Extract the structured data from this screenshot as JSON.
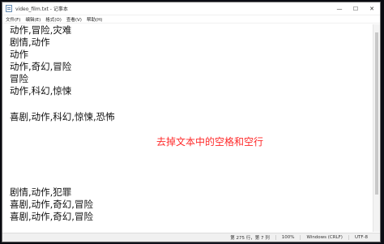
{
  "window": {
    "title": "video_film.txt - 记事本"
  },
  "controls": {
    "minimize": "—",
    "maximize": "☐",
    "close": "✕"
  },
  "menu": {
    "items": [
      "文件(F)",
      "编辑(E)",
      "格式(O)",
      "查看(V)",
      "帮助(H)"
    ]
  },
  "editor": {
    "lines": [
      "动作,冒险,灾难",
      "剧情,动作",
      "动作",
      "动作,奇幻,冒险",
      "冒险",
      "动作,科幻,惊悚",
      "喜剧,动作,科幻,惊悚,恐怖",
      "剧情,动作,犯罪",
      "喜剧,动作,奇幻,冒险",
      "喜剧,动作,奇幻,冒险"
    ]
  },
  "overlay": {
    "text": "去掉文本中的空格和空行",
    "color": "#ff2a2a"
  },
  "status": {
    "position": "第 275 行，第 7 列",
    "zoom": "100%",
    "line_ending": "Windows (CRLF)",
    "encoding": "UTF-8"
  }
}
